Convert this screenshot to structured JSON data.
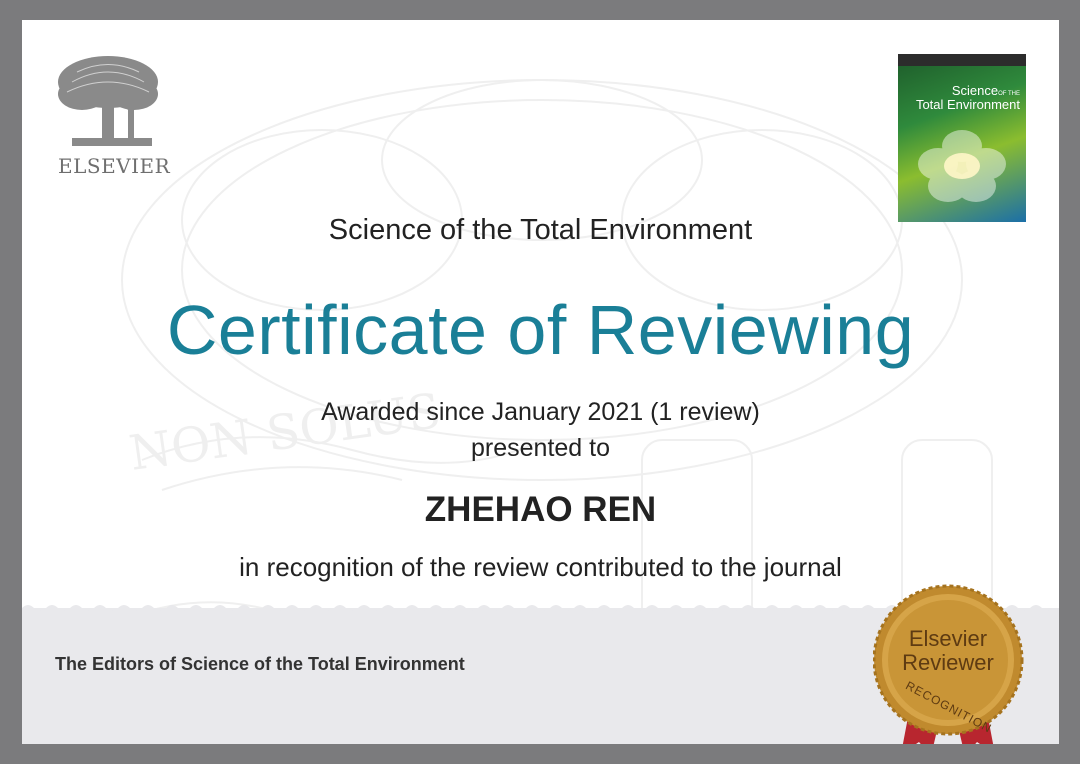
{
  "publisher": {
    "logo_text": "ELSEVIER"
  },
  "cover": {
    "title_line1": "Science",
    "title_line1_small": "OF THE",
    "title_line2": "Total Environment"
  },
  "journal_title": "Science of the Total Environment",
  "certificate_title": "Certificate of Reviewing",
  "awarded_text": "Awarded since January 2021 (1 review)",
  "presented_text": "presented to",
  "recipient_name": "ZHEHAO REN",
  "recognition_text": "in recognition of the review contributed to the journal",
  "signature_line": "The Editors of Science of the Total Environment",
  "seal": {
    "line1": "Elsevier",
    "line2": "Reviewer",
    "line3": "RECOGNITION"
  },
  "colors": {
    "accent": "#1a7f97",
    "frame": "#7b7b7d",
    "footer_band": "#e9e9ec",
    "seal_gold": "#c08a2e",
    "ribbon": "#b8262f"
  }
}
